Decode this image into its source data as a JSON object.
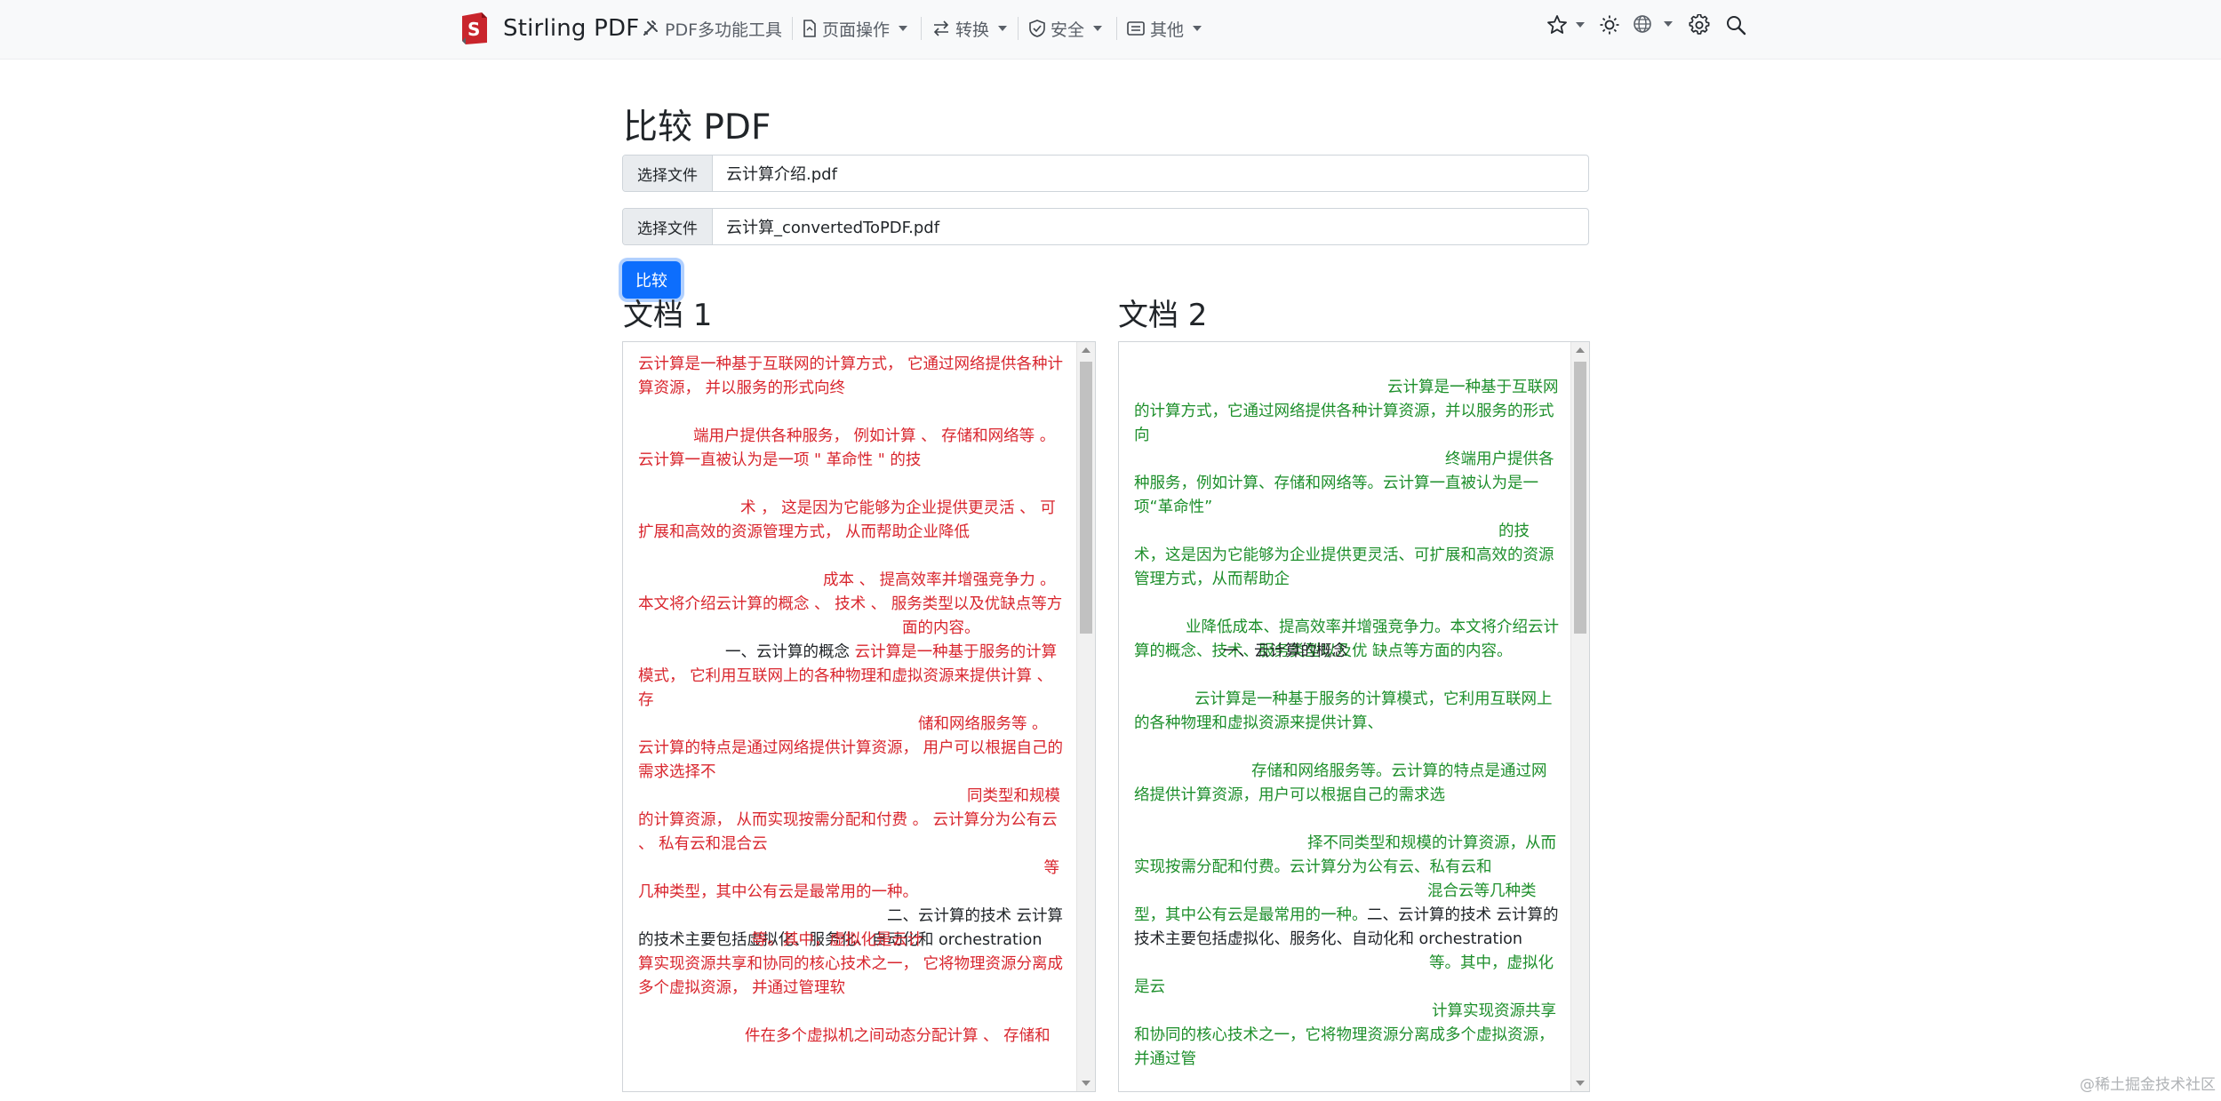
{
  "nav": {
    "brand": "Stirling PDF",
    "items": [
      {
        "label": "PDF多功能工具",
        "icon": "tools-icon"
      },
      {
        "label": "页面操作",
        "icon": "file-icon"
      },
      {
        "label": "转换",
        "icon": "convert-arrows-icon"
      },
      {
        "label": "安全",
        "icon": "shield-icon"
      },
      {
        "label": "其他",
        "icon": "card-list-icon"
      }
    ],
    "right_icons": [
      "star-icon",
      "sun-icon",
      "globe-icon",
      "gear-icon",
      "search-icon"
    ]
  },
  "main": {
    "title": "比较 PDF",
    "file1": {
      "button_label": "选择文件",
      "file_name": "云计算介绍.pdf"
    },
    "file2": {
      "button_label": "选择文件",
      "file_name": "云计算_convertedToPDF.pdf"
    },
    "compare_label": "比较"
  },
  "doc1": {
    "title": "文档 1",
    "lines": [
      {
        "text": "云计算是一种基于互联网的计算方式， 它通过网络提供各种计算资源， 并以服务的形式向终",
        "color": "red"
      },
      {
        "text": "",
        "color": "black"
      },
      {
        "text": "                    端用户提供各种服务， 例如计算 、 存储和网络等 。 云计算一直被认为是一项 \" 革命性 \" 的技",
        "color": "red"
      },
      {
        "text": "",
        "color": "black"
      },
      {
        "text": "                                   术 ， 这是因为它能够为企业提供更灵活 、 可扩展和高效的资源管理方式， 从而帮助企业降低",
        "color": "red"
      },
      {
        "text": "",
        "color": "black"
      },
      {
        "text": "                                                                  成本 、 提高效率并增强竞争力 。 本文将介绍云计算的概念 、 技术 、 服务类型以及优缺点等方",
        "color": "red"
      },
      {
        "text": "                                                                                         面的内容。",
        "color": "red"
      }
    ],
    "section1_heading": "一、云计算的概念",
    "lines2": [
      {
        "text": "云计算是一种基于服务的计算模式， 它利用互联网上的各种物理和虚拟资源来提供计算 、 存",
        "color": "red"
      },
      {
        "text": "                                                                                              储和网络服务等 。 云计算的特点是通过网络提供计算资源， 用户可以根据自己的需求选择不",
        "color": "red"
      },
      {
        "text": "                                                                                                         同类型和规模的计算资源， 从而实现按需分配和付费 。 云计算分为公有云 、 私有云和混合云",
        "color": "red"
      },
      {
        "text": "                                                                                                                                           等",
        "color": "red"
      },
      {
        "text": "几种类型，其中公有云是最常用的一种。",
        "color": "red"
      }
    ],
    "section2_heading": "二、云计算的技术  云计算的技术主要包括虚拟化、服务化、自动化和 orchestration",
    "lines3": [
      {
        "text": "等。其中，虚拟化是云计",
        "color": "red"
      },
      {
        "text": "         算实现资源共享和协同的核心技术之一， 它将物理资源分离成多个虚拟资源， 并通过管理软",
        "color": "red"
      },
      {
        "text": "",
        "color": "black"
      },
      {
        "text": "                                   件在多个虚拟机之间动态分配计算 、 存储和",
        "color": "red"
      }
    ]
  },
  "doc2": {
    "title": "文档 2",
    "blocks": [
      {
        "text": "                                                              云计算是一种基于互联网的计算方式，它通过网络提供各种计算资源，并以服务的形式向",
        "color": "green"
      },
      {
        "text": "                                                                                      终端用户提供各种服务，例如计算、存储和网络等。云计算一直被认为是一项“革命性”",
        "color": "green"
      },
      {
        "text": "                                                                                                          的技术，这是因为它能够为企业提供更灵活、可扩展和高效的资源管理方式，从而帮助企",
        "color": "green"
      },
      {
        "text": "",
        "color": "black"
      },
      {
        "text": "         业降低成本、提高效率并增强竞争力。本文将介绍云计算的概念、技术、服务类型以及优                  缺点等方面的内容。",
        "color": "green"
      },
      {
        "text": "一、云计算的概念",
        "color": "black"
      },
      {
        "text": "",
        "color": "black"
      },
      {
        "text": "           云计算是一种基于服务的计算模式，它利用互联网上的各种物理和虚拟资源来提供计算、",
        "color": "green"
      },
      {
        "text": "",
        "color": "black"
      },
      {
        "text": "                        存储和网络服务等。云计算的特点是通过网络提供计算资源，用户可以根据自己的需求选",
        "color": "green"
      },
      {
        "text": "",
        "color": "black"
      },
      {
        "text": "                                                           择不同类型和规模的计算资源，从而实现按需分配和付费。云计算分为公有云、私有云和",
        "color": "green"
      },
      {
        "text": "                                                                                                  混合云等几种类型，其中公有云是最常用的一种。",
        "color": "green"
      },
      {
        "text": "二、云计算的技术  云计算的技术主要包括虚拟化、服务化、自动化和 orchestration",
        "color": "black"
      },
      {
        "text": "                                                                                                  等。其中，虚拟化是云",
        "color": "green"
      },
      {
        "text": "                                                                                                      计算实现资源共享和协同的核心技术之一，它将物理资源分离成多个虚拟资源，并通过管",
        "color": "green"
      }
    ]
  },
  "watermark": "@稀土掘金技术社区",
  "colors": {
    "accent": "#0d6efd",
    "removed": "#d9262e",
    "added": "#1d8f2b"
  }
}
